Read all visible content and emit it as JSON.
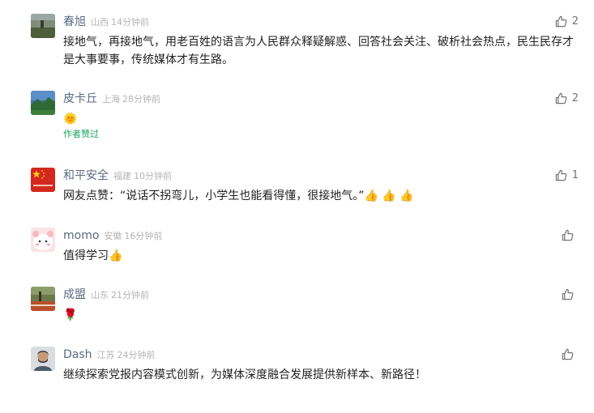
{
  "comments": [
    {
      "name": "春旭",
      "region": "山西",
      "time": "14分钟前",
      "likes": "2",
      "text": "接地气，再接地气，用老百姓的语言为人民群众释疑解惑、回答社会关注、破析社会热点，民生民存才是大事要事，传统媒体才有生路。"
    },
    {
      "name": "皮卡丘",
      "region": "上海",
      "time": "28分钟前",
      "likes": "2",
      "text": "🌞",
      "author_liked": "作者赞过"
    },
    {
      "name": "和平安全",
      "region": "福建",
      "time": "10分钟前",
      "likes": "1",
      "text": "网友点赞：“说话不拐弯儿，小学生也能看得懂，很接地气。”👍 👍 👍"
    },
    {
      "name": "momo",
      "region": "安徽",
      "time": "16分钟前",
      "likes": "",
      "text": "值得学习👍"
    },
    {
      "name": "成盟",
      "region": "山东",
      "time": "21分钟前",
      "likes": "",
      "text": "🌹"
    },
    {
      "name": "Dash",
      "region": "江苏",
      "time": "24分钟前",
      "likes": "",
      "text": "继续探索党报内容模式创新，为媒体深度融合发展提供新样本、新路径！"
    }
  ],
  "icons": {
    "like": "thumbs-up-outline-icon"
  },
  "colors": {
    "name": "#5a6a82",
    "meta": "#b4b4b4",
    "text": "#222222",
    "author_liked": "#17a35f",
    "like_icon": "#737373"
  }
}
